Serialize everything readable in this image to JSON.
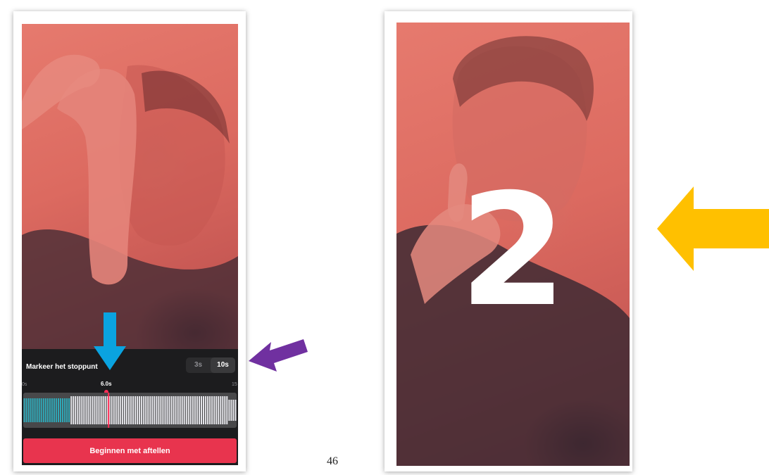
{
  "left_screen": {
    "sheet_title": "Markeer het stoppunt",
    "duration_options": [
      "3s",
      "10s"
    ],
    "selected_duration": "10s",
    "timeline": {
      "start_label": "0s",
      "current_label": "6.0s",
      "end_label": "15",
      "playhead_fraction": 0.4
    },
    "start_button_label": "Beginnen met aftellen",
    "accent_color": "#e8344e",
    "waveform_selected_color": "#2fa9b8"
  },
  "right_screen": {
    "countdown_value": "2"
  },
  "annotations": {
    "blue_arrow_color": "#0aa3e0",
    "purple_arrow_color": "#7030a0",
    "orange_arrow_color": "#ffc000"
  },
  "page_number": "46"
}
